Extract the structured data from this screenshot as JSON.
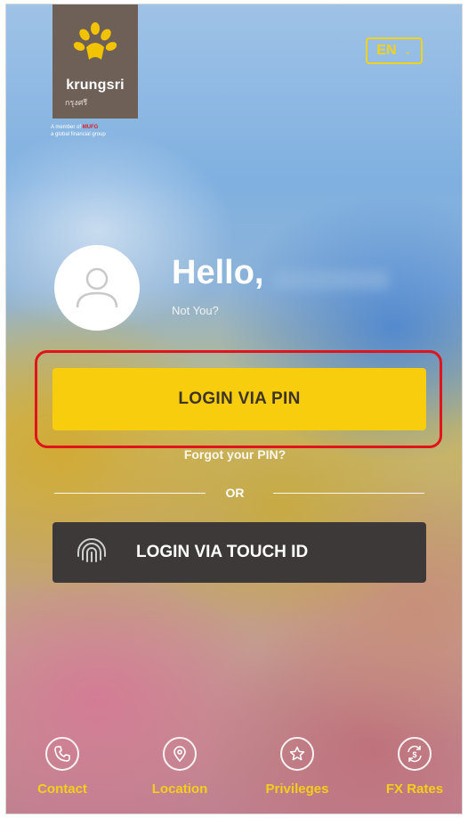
{
  "brand": {
    "name": "krungsri",
    "thai_name": "กรุงศรี",
    "member_prefix": "A member of",
    "member_group": "MUFG",
    "member_suffix": "a global financial group",
    "logo_color": "#f2c300",
    "panel_color": "#6e5f57"
  },
  "language": {
    "current": "EN",
    "icon": "chevron-down-icon"
  },
  "greeting": {
    "hello": "Hello,",
    "not_you": "Not You?"
  },
  "login": {
    "pin_label": "LOGIN VIA PIN",
    "forgot_pin": "Forgot your PIN?",
    "or": "OR",
    "touch_label": "LOGIN VIA TOUCH ID",
    "touch_icon": "fingerprint-icon"
  },
  "nav": {
    "items": [
      {
        "label": "Contact",
        "icon": "phone-icon"
      },
      {
        "label": "Location",
        "icon": "location-pin-icon"
      },
      {
        "label": "Privileges",
        "icon": "star-icon"
      },
      {
        "label": "FX Rates",
        "icon": "currency-exchange-icon"
      }
    ]
  },
  "colors": {
    "accent_yellow": "#f7cd0e",
    "highlight_red": "#e0141b",
    "touch_button": "#3d3938",
    "nav_label": "#f3cf1a"
  }
}
